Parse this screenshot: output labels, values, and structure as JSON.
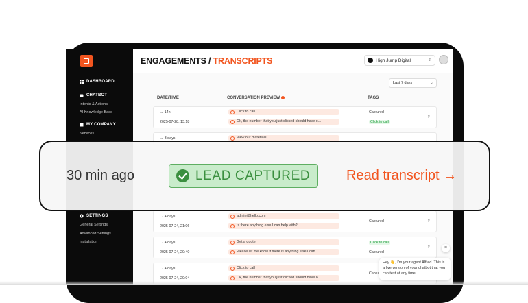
{
  "sidebar": {
    "dashboard": "DASHBOARD",
    "chatbot": "CHATBOT",
    "intents": "Intents & Actions",
    "knowledge": "AI Knowledge Base",
    "company": "MY COMPANY",
    "services": "Services",
    "settings": "SETTINGS",
    "general": "General Settings",
    "advanced": "Advanced Settings",
    "installation": "Installation"
  },
  "header": {
    "title_a": "ENGAGEMENTS /",
    "title_b": "TRANSCRIPTS",
    "org": "High Jump Digital"
  },
  "filter": {
    "range": "Last 7 days"
  },
  "columns": {
    "date": "DATE/TIME",
    "preview": "CONVERSATION PREVIEW",
    "tags": "TAGS"
  },
  "rows": [
    {
      "ago": "→ 14h",
      "date": "2025-07-28, 13:18",
      "msg1": "Click to call",
      "msg2": "Ok, the number that you just clicked should have o...",
      "tag1": "Captured",
      "tag2": "Click to call",
      "flag": "⚐"
    },
    {
      "ago": "→ 3 days",
      "msg1": "View our materials"
    },
    {
      "ago": "→ 4 days",
      "date": "2025-07-24, 21:06",
      "msg1": "admin@hello.com",
      "msg2": "Is there anything else I can help with?",
      "tag1": "Captured",
      "flag": "⚐"
    },
    {
      "ago": "→ 4 days",
      "date": "2025-07-24, 20:40",
      "msg1": "Get a quote",
      "msg2": "Please let me know if there is anything else I can...",
      "tag1": "Click to call",
      "tag2": "Captured",
      "flag": "⚐"
    },
    {
      "ago": "→ 4 days",
      "date": "2025-07-24, 20:04",
      "msg1": "Click to call",
      "msg2": "Ok, the number that you just clicked should have o...",
      "tag1": "Captured"
    }
  ],
  "highlight": {
    "time": "30 min ago",
    "badge": "LEAD CAPTURED",
    "link": "Read transcript →"
  },
  "chat_bubble": {
    "text": "Hey 👋, I'm your agent Alfred. This is a live version of your chatbot that you can test at any time.",
    "close": "×"
  },
  "colors": {
    "accent": "#f2551f",
    "success": "#3b8f3f",
    "sidebar": "#0b0b0b"
  }
}
